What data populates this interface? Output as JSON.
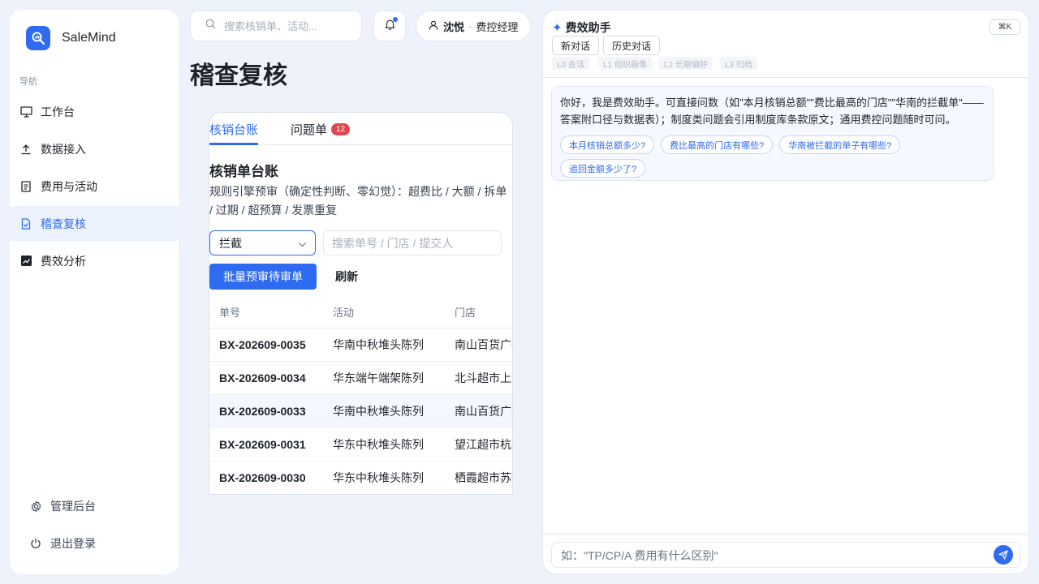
{
  "brand": {
    "name": "SaleMind",
    "accent": "#2f6bf0"
  },
  "sidebar": {
    "section_label": "导航",
    "items": [
      {
        "label": "工作台",
        "icon": "monitor-icon"
      },
      {
        "label": "数据接入",
        "icon": "upload-icon"
      },
      {
        "label": "费用与活动",
        "icon": "document-icon"
      },
      {
        "label": "稽查复核",
        "icon": "audit-check-icon",
        "active": true
      },
      {
        "label": "费效分析",
        "icon": "chart-icon"
      }
    ],
    "footer": {
      "admin": "管理后台",
      "logout": "退出登录"
    }
  },
  "topbar": {
    "search_placeholder": "搜索核销单、活动...",
    "user": {
      "name": "沈悦",
      "separator": "·",
      "role": "费控经理"
    }
  },
  "page": {
    "title": "稽查复核"
  },
  "card": {
    "tabs": [
      {
        "label": "核销台账"
      },
      {
        "label": "问题单",
        "badge": "12"
      }
    ],
    "heading": "核销单台账",
    "description": "规则引擎预审（确定性判断、零幻觉）：超费比 / 大额 / 拆单 / 过期 / 超预算 / 发票重复",
    "status_select": "拦截",
    "filter_placeholder": "搜索单号 / 门店 / 提交人",
    "batch_button": "批量预审待审单",
    "refresh_button": "刷新",
    "table": {
      "columns": [
        "单号",
        "活动",
        "门店"
      ],
      "rows": [
        [
          "BX-202609-0035",
          "华南中秋堆头陈列",
          "南山百货广州"
        ],
        [
          "BX-202609-0034",
          "华东端午端架陈列",
          "北斗超市上海"
        ],
        [
          "BX-202609-0033",
          "华南中秋堆头陈列",
          "南山百货广州"
        ],
        [
          "BX-202609-0031",
          "华东中秋堆头陈列",
          "望江超市杭州"
        ],
        [
          "BX-202609-0030",
          "华东中秋堆头陈列",
          "栖霞超市苏州"
        ]
      ]
    }
  },
  "assistant": {
    "title": "费效助手",
    "shortcut": "⌘K",
    "new_chat": "新对话",
    "history": "历史对话",
    "levels": [
      "L0 会话",
      "L1 组织画像",
      "L2 长期偏好",
      "L3 归档"
    ],
    "greeting": "你好，我是费效助手。可直接问数（如\"本月核销总额\"\"费比最高的门店\"\"华南的拦截单\"——答案附口径与数据表）；制度类问题会引用制度库条款原文；通用费控问题随时可问。",
    "suggestions": [
      "本月核销总额多少?",
      "费比最高的门店有哪些?",
      "华南被拦截的单子有哪些?",
      "追回金额多少了?"
    ],
    "input_placeholder": "如：\"TP/CP/A 费用有什么区别\""
  }
}
